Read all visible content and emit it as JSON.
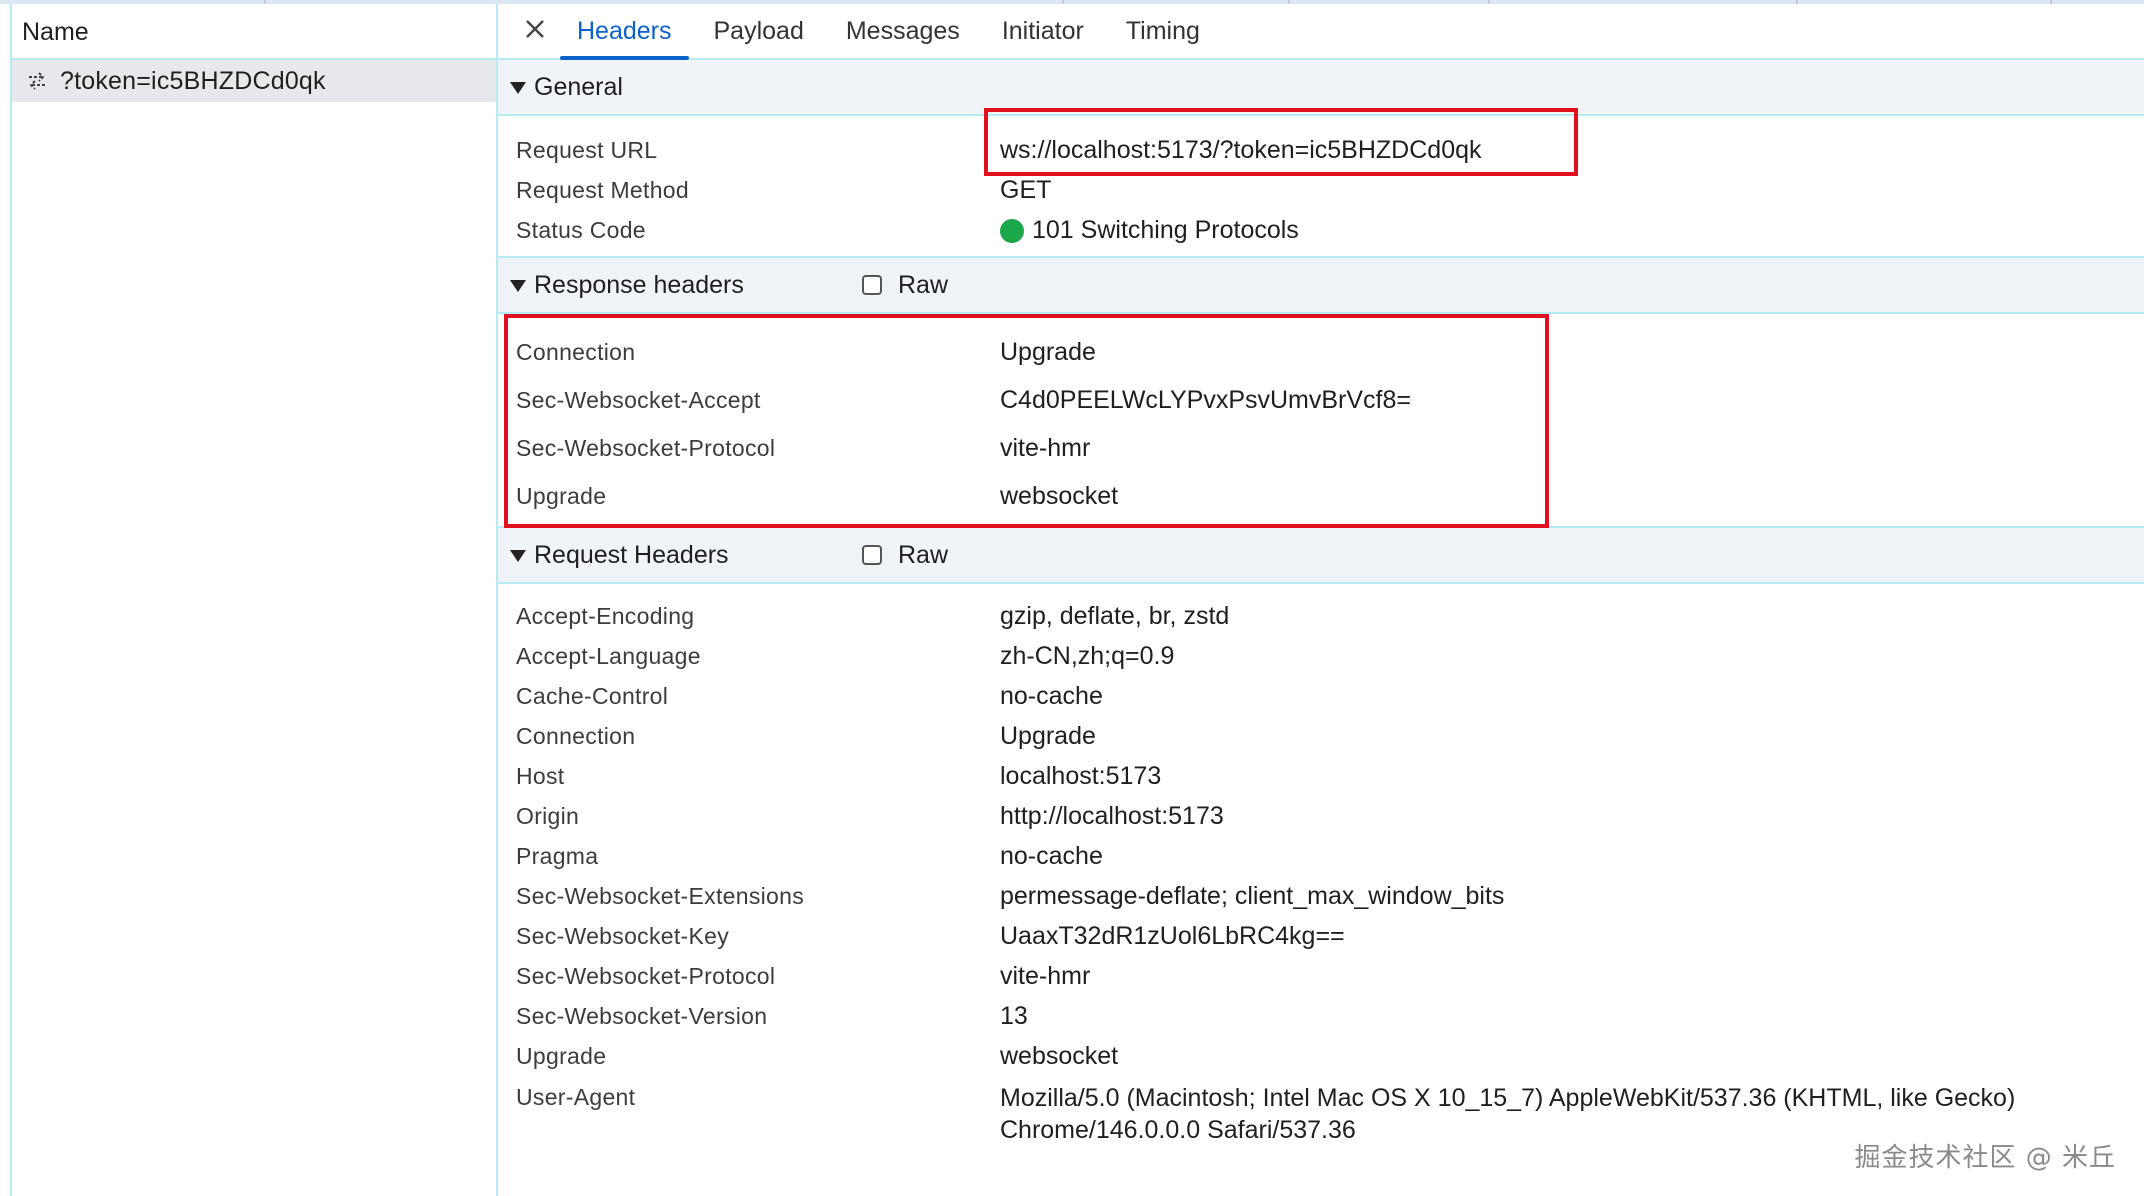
{
  "left": {
    "column_header": "Name",
    "requests": [
      {
        "label": "?token=ic5BHZDCd0qk",
        "icon": "websocket-arrows-icon"
      }
    ]
  },
  "tabs": [
    {
      "label": "Headers",
      "active": true
    },
    {
      "label": "Payload",
      "active": false
    },
    {
      "label": "Messages",
      "active": false
    },
    {
      "label": "Initiator",
      "active": false
    },
    {
      "label": "Timing",
      "active": false
    }
  ],
  "general": {
    "title": "General",
    "rows": [
      {
        "key": "Request URL",
        "value": "ws://localhost:5173/?token=ic5BHZDCd0qk"
      },
      {
        "key": "Request Method",
        "value": "GET"
      },
      {
        "key": "Status Code",
        "value": "101 Switching Protocols"
      }
    ],
    "status_color": "#1aa84a"
  },
  "response_headers": {
    "title": "Response headers",
    "raw_label": "Raw",
    "rows": [
      {
        "key": "Connection",
        "value": "Upgrade"
      },
      {
        "key": "Sec-Websocket-Accept",
        "value": "C4d0PEELWcLYPvxPsvUmvBrVcf8="
      },
      {
        "key": "Sec-Websocket-Protocol",
        "value": "vite-hmr"
      },
      {
        "key": "Upgrade",
        "value": "websocket"
      }
    ]
  },
  "request_headers": {
    "title": "Request Headers",
    "raw_label": "Raw",
    "rows": [
      {
        "key": "Accept-Encoding",
        "value": "gzip, deflate, br, zstd"
      },
      {
        "key": "Accept-Language",
        "value": "zh-CN,zh;q=0.9"
      },
      {
        "key": "Cache-Control",
        "value": "no-cache"
      },
      {
        "key": "Connection",
        "value": "Upgrade"
      },
      {
        "key": "Host",
        "value": "localhost:5173"
      },
      {
        "key": "Origin",
        "value": "http://localhost:5173"
      },
      {
        "key": "Pragma",
        "value": "no-cache"
      },
      {
        "key": "Sec-Websocket-Extensions",
        "value": "permessage-deflate; client_max_window_bits"
      },
      {
        "key": "Sec-Websocket-Key",
        "value": "UaaxT32dR1zUol6LbRC4kg=="
      },
      {
        "key": "Sec-Websocket-Protocol",
        "value": "vite-hmr"
      },
      {
        "key": "Sec-Websocket-Version",
        "value": "13"
      },
      {
        "key": "Upgrade",
        "value": "websocket"
      },
      {
        "key": "User-Agent",
        "value_line1": "Mozilla/5.0 (Macintosh; Intel Mac OS X 10_15_7) AppleWebKit/537.36 (KHTML, like Gecko)",
        "value_line2": "Chrome/146.0.0.0 Safari/537.36"
      }
    ]
  },
  "watermark": "掘金技术社区 @ 米丘",
  "highlight_color": "#e0101f",
  "accent_color": "#0b63c9"
}
